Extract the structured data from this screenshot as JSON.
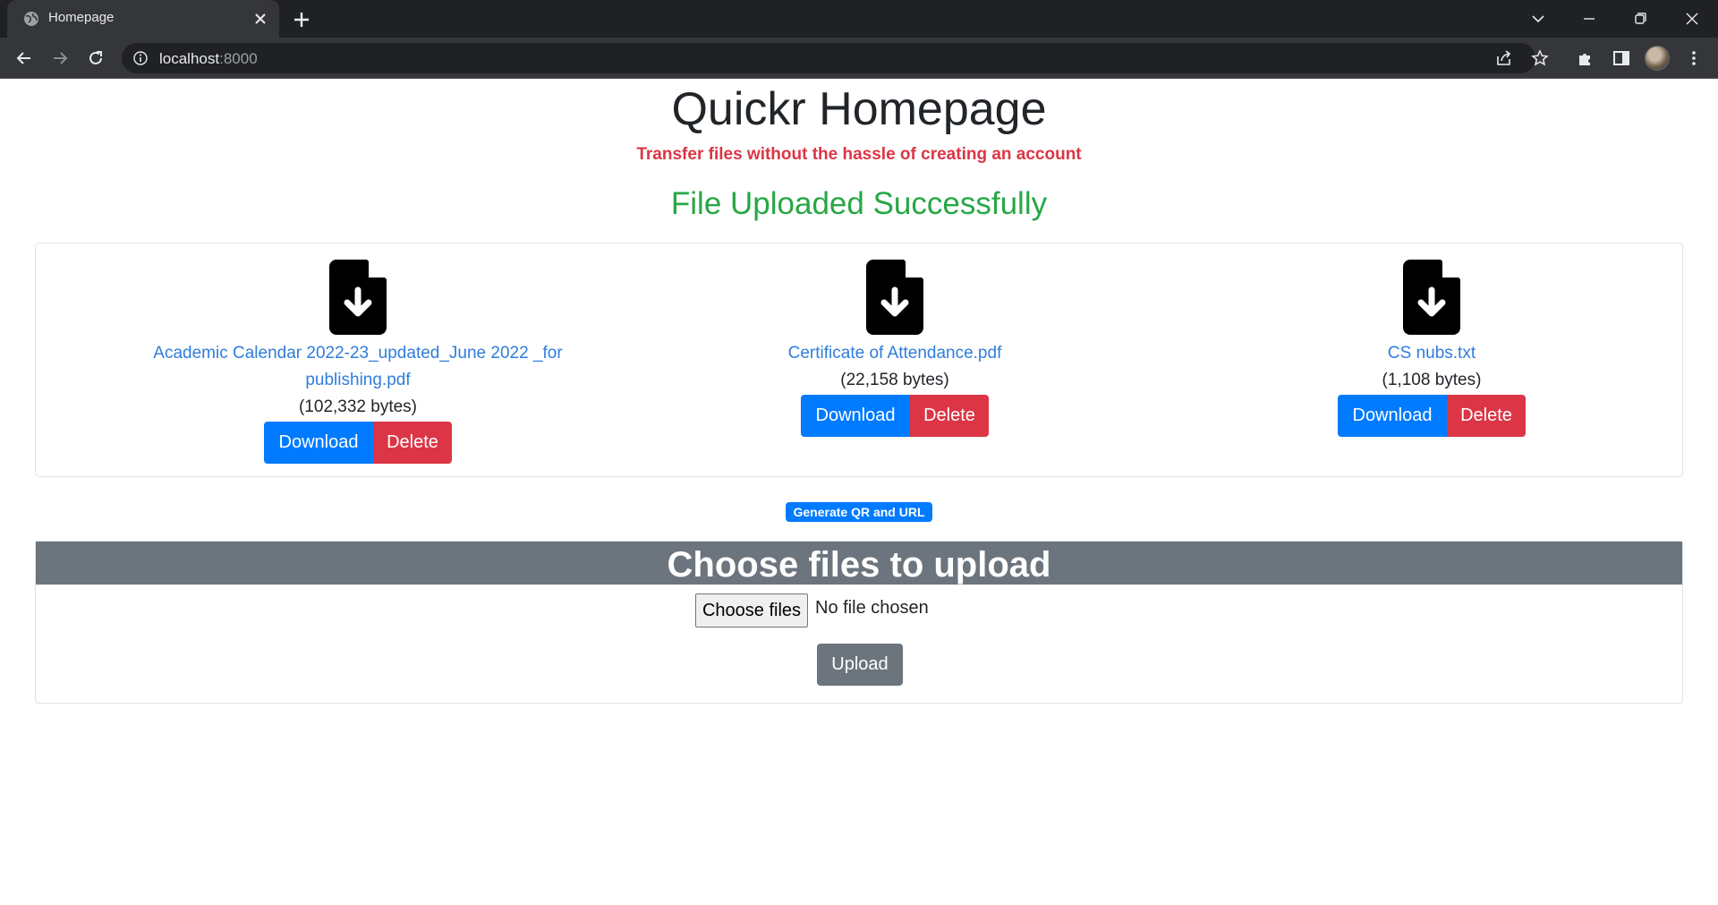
{
  "browser": {
    "tab_title": "Homepage",
    "url_host": "localhost",
    "url_port": ":8000"
  },
  "page": {
    "title": "Quickr Homepage",
    "subtitle": "Transfer files without the hassle of creating an account",
    "status": "File Uploaded Successfully"
  },
  "files": [
    {
      "name_line1": "Academic Calendar 2022-23_updated_June 2022 _for",
      "name_line2": "publishing.pdf",
      "size": "(102,332 bytes)",
      "download_label": "Download",
      "delete_label": "Delete",
      "icon": "file-download-icon"
    },
    {
      "name_line1": "Certificate of Attendance.pdf",
      "name_line2": "",
      "size": "(22,158 bytes)",
      "download_label": "Download",
      "delete_label": "Delete",
      "icon": "file-download-icon"
    },
    {
      "name_line1": "CS nubs.txt",
      "name_line2": "",
      "size": "(1,108 bytes)",
      "download_label": "Download",
      "delete_label": "Delete",
      "icon": "file-download-icon"
    }
  ],
  "generate": {
    "label": "Generate QR and URL"
  },
  "upload": {
    "header": "Choose files to upload",
    "choose_label": "Choose files",
    "no_file_text": "No file chosen",
    "upload_label": "Upload"
  },
  "colors": {
    "primary": "#007bff",
    "danger": "#dc3545",
    "success": "#28a745",
    "secondary": "#6c757d"
  }
}
